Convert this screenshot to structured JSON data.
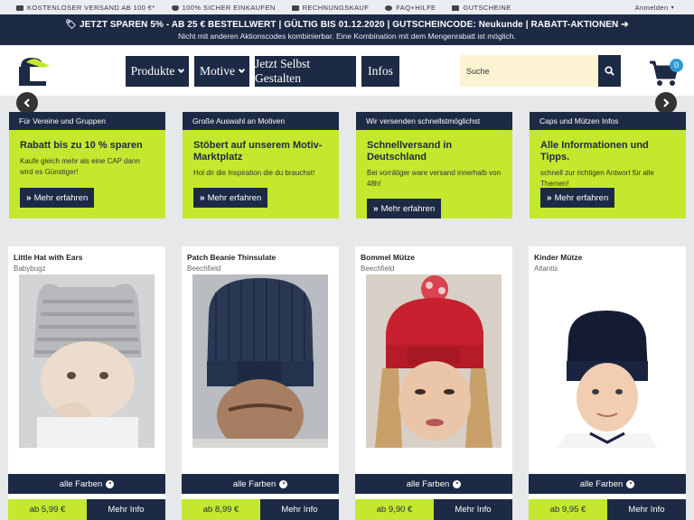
{
  "topbar": {
    "items": [
      {
        "icon": "truck-icon",
        "label": "KOSTENLOSER VERSAND AB 100 €*"
      },
      {
        "icon": "shield-icon",
        "label": "100% SICHER EINKAUFEN"
      },
      {
        "icon": "invoice-icon",
        "label": "RECHNUNGSKAUF"
      },
      {
        "icon": "chat-icon",
        "label": "FAQ+HILFE"
      },
      {
        "icon": "gift-icon",
        "label": "GUTSCHEINE"
      }
    ],
    "login": "Anmelden"
  },
  "promo": {
    "line1": "JETZT SPAREN 5% - AB 25 € BESTELLWERT | GÜLTIG BIS 01.12.2020 | GUTSCHEINCODE: Neukunde | RABATT-AKTIONEN",
    "line2": "Nicht mit anderen Aktionscodes kombinierbar. Eine Kombination mit dem Mengenrabatt ist möglich."
  },
  "nav": {
    "items": [
      {
        "label": "Produkte",
        "dropdown": true
      },
      {
        "label": "Motive",
        "dropdown": true
      },
      {
        "label": "Jetzt Selbst Gestalten",
        "dropdown": false
      },
      {
        "label": "Infos",
        "dropdown": false
      }
    ]
  },
  "search": {
    "placeholder": "Suche"
  },
  "cart": {
    "count": "0"
  },
  "colors": {
    "navy": "#1d2a45",
    "lime": "#c4e82d",
    "badge": "#2f9bd3"
  },
  "promo_cards": [
    {
      "header": "Für Vereine und Gruppen",
      "title": "Rabatt bis zu 10 % sparen",
      "desc": "Kaufe gleich mehr als eine CAP dann wird es Günstiger!",
      "button": "Mehr erfahren"
    },
    {
      "header": "Große Auswahl an Motiven",
      "title": "Stöbert auf unserem Motiv-Marktplatz",
      "desc": "Hol dir die Inspiration die du brauchst!",
      "button": "Mehr erfahren"
    },
    {
      "header": "Wir versenden schnellstmöglichst",
      "title": "Schnellversand in Deutschland",
      "desc": "Bei vorrätiger ware versand innerhalb von 48h!",
      "button": "Mehr erfahren"
    },
    {
      "header": "Caps und Mützen Infos",
      "title": "Alle Informationen und Tipps.",
      "desc": "schnell zur richtigen Antwort für alle Themen!",
      "button": "Mehr erfahren"
    }
  ],
  "products": [
    {
      "name": "Little Hat with Ears",
      "brand": "Babybugz",
      "colors_label": "alle Farben",
      "price": "ab 5,99 €",
      "more": "Mehr Info"
    },
    {
      "name": "Patch Beanie Thinsulate",
      "brand": "Beechfield",
      "colors_label": "alle Farben",
      "price": "ab 8,99 €",
      "more": "Mehr Info"
    },
    {
      "name": "Bommel Mütze",
      "brand": "Beechfield",
      "colors_label": "alle Farben",
      "price": "ab 9,90 €",
      "more": "Mehr Info"
    },
    {
      "name": "Kinder Mütze",
      "brand": "Atlantis",
      "colors_label": "alle Farben",
      "price": "ab 9,95 €",
      "more": "Mehr Info"
    }
  ]
}
